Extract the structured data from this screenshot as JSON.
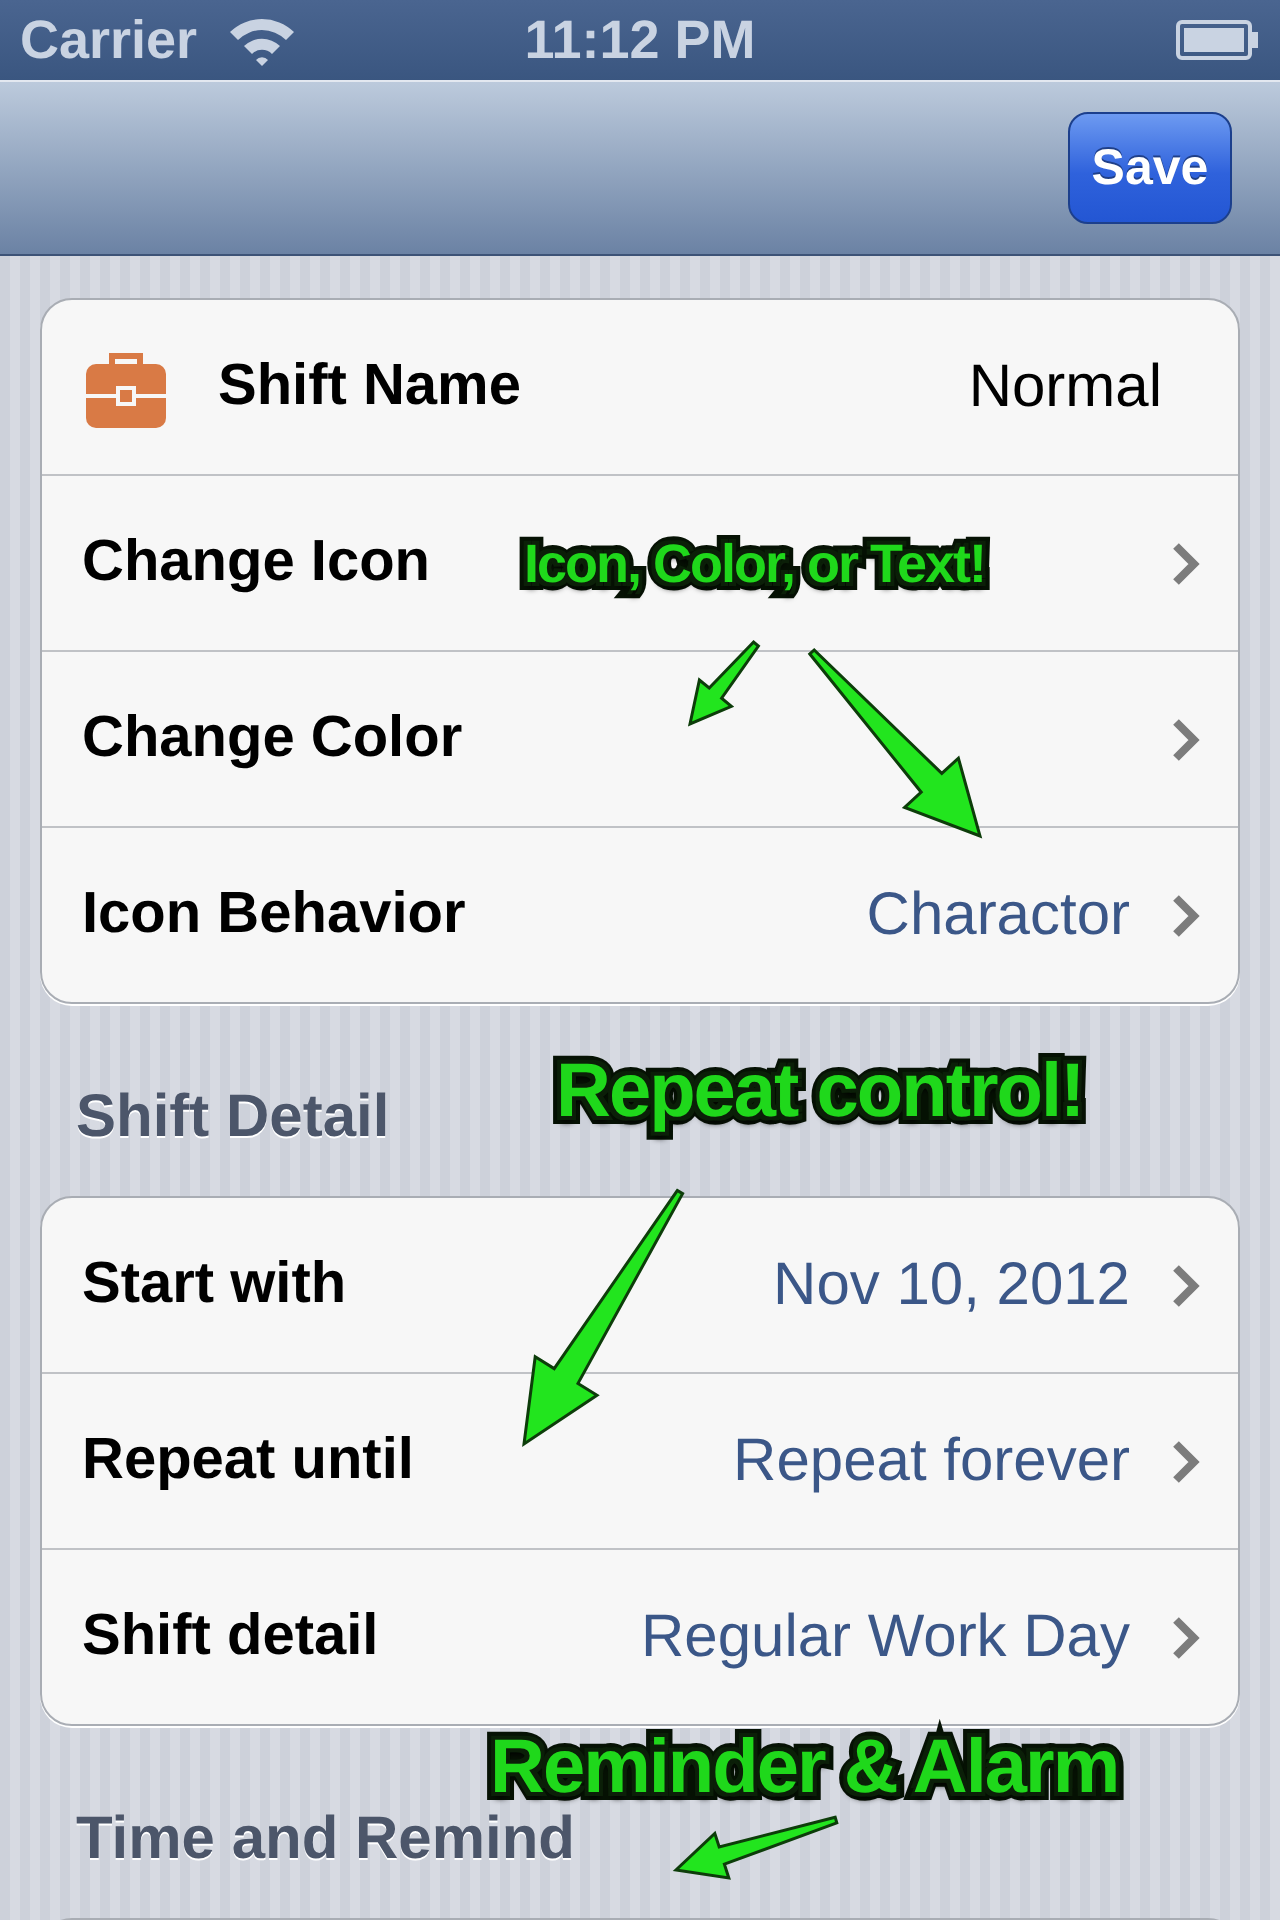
{
  "status_bar": {
    "carrier": "Carrier",
    "time": "11:12 PM"
  },
  "nav_bar": {
    "save_button": "Save"
  },
  "sections": [
    {
      "rows": [
        {
          "kind": "name",
          "label": "Shift Name",
          "value": "Normal"
        },
        {
          "kind": "disclosure",
          "label": "Change Icon"
        },
        {
          "kind": "disclosure",
          "label": "Change Color"
        },
        {
          "kind": "disclosure",
          "label": "Icon Behavior",
          "value": "Charactor"
        }
      ]
    },
    {
      "header": "Shift Detail",
      "rows": [
        {
          "kind": "disclosure",
          "label": "Start with",
          "value": "Nov 10, 2012"
        },
        {
          "kind": "disclosure",
          "label": "Repeat until",
          "value": "Repeat forever"
        },
        {
          "kind": "disclosure",
          "label": "Shift detail",
          "value": "Regular Work Day"
        }
      ]
    },
    {
      "header": "Time and Remind"
    }
  ],
  "annotations": [
    {
      "text": "Icon, Color, or Text!"
    },
    {
      "text": "Repeat control!"
    },
    {
      "text": "Reminder & Alarm"
    }
  ]
}
